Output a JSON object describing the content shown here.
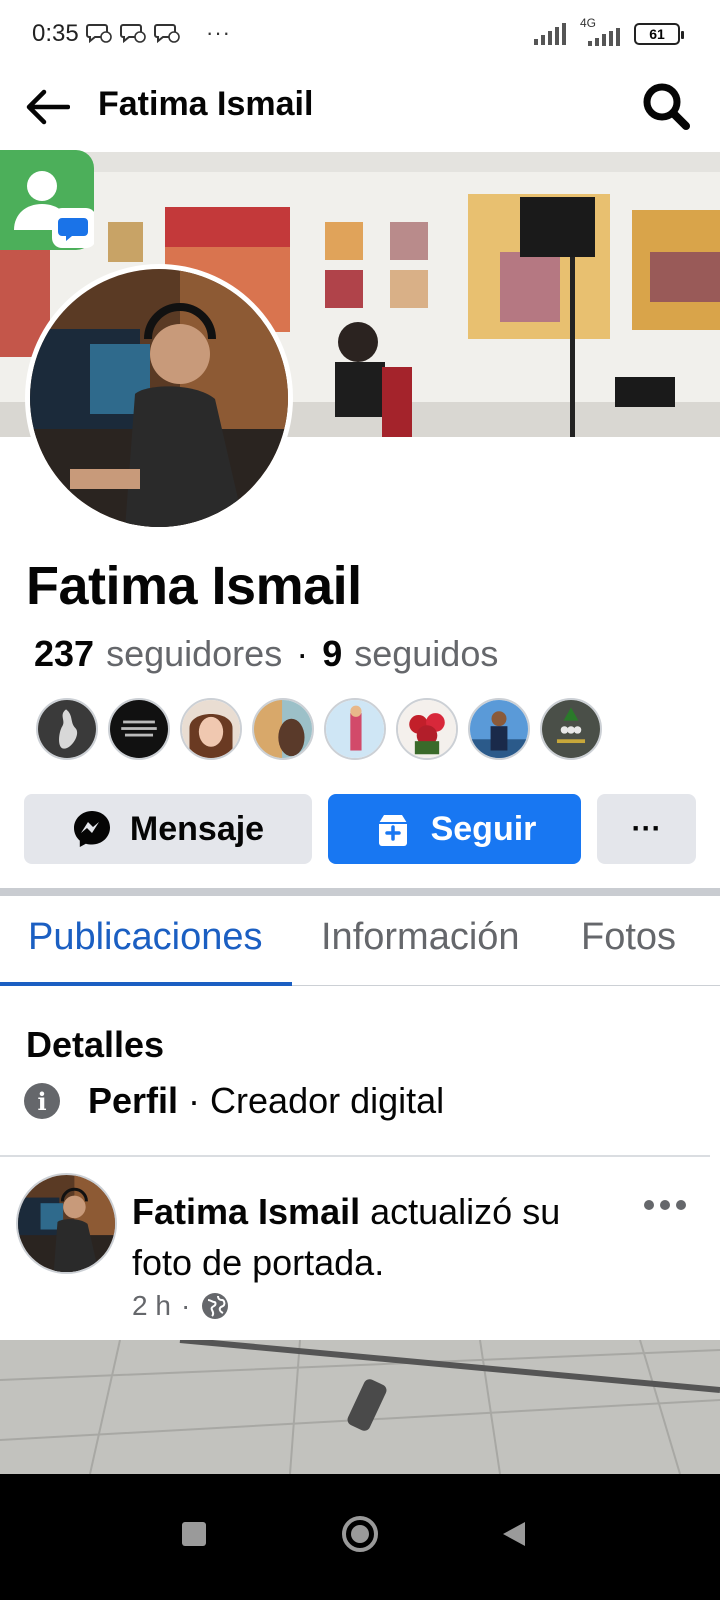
{
  "status_bar": {
    "time": "0:35",
    "more": "···",
    "network": "4G",
    "battery": "61"
  },
  "header": {
    "title": "Fatima Ismail"
  },
  "profile": {
    "name": "Fatima Ismail",
    "followers_count": "237",
    "followers_label": "seguidores",
    "separator": "·",
    "following_count": "9",
    "following_label": "seguidos"
  },
  "follower_avatars": [
    {
      "color": "#3a3a3a"
    },
    {
      "color": "#1a1a1a"
    },
    {
      "color": "#c9a48a"
    },
    {
      "color": "#7aa0a8"
    },
    {
      "color": "#9fc2d8"
    },
    {
      "color": "#b0282a"
    },
    {
      "color": "#3c6fa0"
    },
    {
      "color": "#5a5e54"
    }
  ],
  "actions": {
    "message_label": "Mensaje",
    "follow_label": "Seguir",
    "more_label": "···"
  },
  "tabs": [
    {
      "label": "Publicaciones",
      "active": true
    },
    {
      "label": "Información",
      "active": false
    },
    {
      "label": "Fotos",
      "active": false
    }
  ],
  "details": {
    "title": "Detalles",
    "category_label": "Perfil",
    "category_value": "· Creador digital"
  },
  "post": {
    "author": "Fatima Ismail",
    "action_text": "actualizó su foto de portada.",
    "time": "2 h",
    "dot": "·",
    "privacy_icon": "globe-icon"
  },
  "colors": {
    "accent": "#1877f2",
    "tab_active": "#1b5fc2",
    "secondary_text": "#65676b",
    "button_gray": "#e4e6eb"
  }
}
